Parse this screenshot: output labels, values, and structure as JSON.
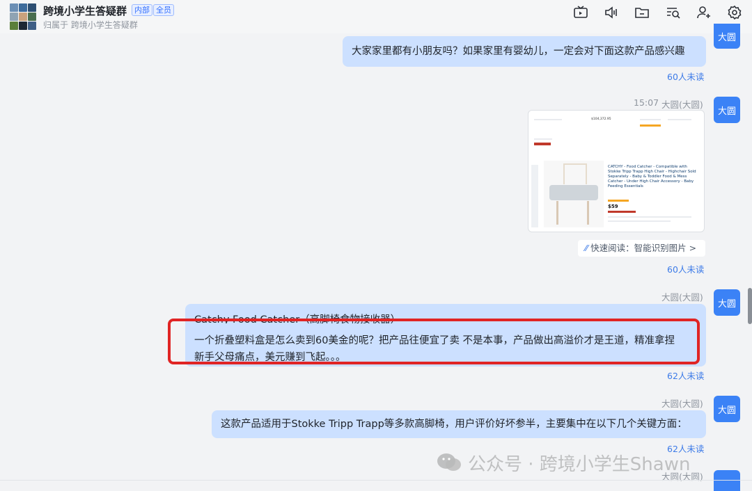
{
  "header": {
    "title": "跨境小学生答疑群",
    "tags": [
      "内部",
      "全员"
    ],
    "subtitle": "归属于 跨境小学生答疑群",
    "icons": [
      "tv-icon",
      "speaker-icon",
      "folder-icon",
      "search-list-icon",
      "add-member-icon",
      "settings-icon"
    ]
  },
  "messages": [
    {
      "sender_avatar": "大圆",
      "text": "大家家里都有小朋友吗？如果家里有婴幼儿，一定会对下面这款产品感兴趣",
      "unread": "60人未读"
    },
    {
      "time": "15:07",
      "sender": "大圆(大圆)",
      "sender_avatar": "大圆",
      "image": {
        "product_title": "CATCHY - Food Catcher - Compatible with Stokke Tripp Trapp High Chair - Highchair Sold Separately - Baby & Toddler Food & Mess Catcher - Under High Chair Accessory - Baby Feeding Essentials",
        "price": "$59",
        "stat_value": "$104,372.95"
      },
      "quick_read": "快速阅读：智能识别图片 >",
      "unread": "60人未读"
    },
    {
      "sender": "大圆(大圆)",
      "sender_avatar": "大圆",
      "line1": "Catchy Food Catcher（高脚椅食物接收器）",
      "line2": "一个折叠塑料盒是怎么卖到60美金的呢？把产品往便宜了卖 不是本事，产品做出高溢价才是王道，精准拿捏",
      "line3": "新手父母痛点，美元赚到飞起。。。",
      "unread": "62人未读"
    },
    {
      "sender": "大圆(大圆)",
      "sender_avatar": "大圆",
      "text": "这款产品适用于Stokke Tripp Trapp等多款高脚椅，用户评价好坏参半，主要集中在以下几个关键方面：",
      "unread": "62人未读"
    },
    {
      "sender": "大圆(大圆)"
    }
  ],
  "watermark": "公众号 · 跨境小学生Shawn",
  "colors": {
    "bubble": "#cce0ff",
    "avatar": "#3b82f6",
    "highlight": "#e02424",
    "unread": "#3d7be8"
  }
}
